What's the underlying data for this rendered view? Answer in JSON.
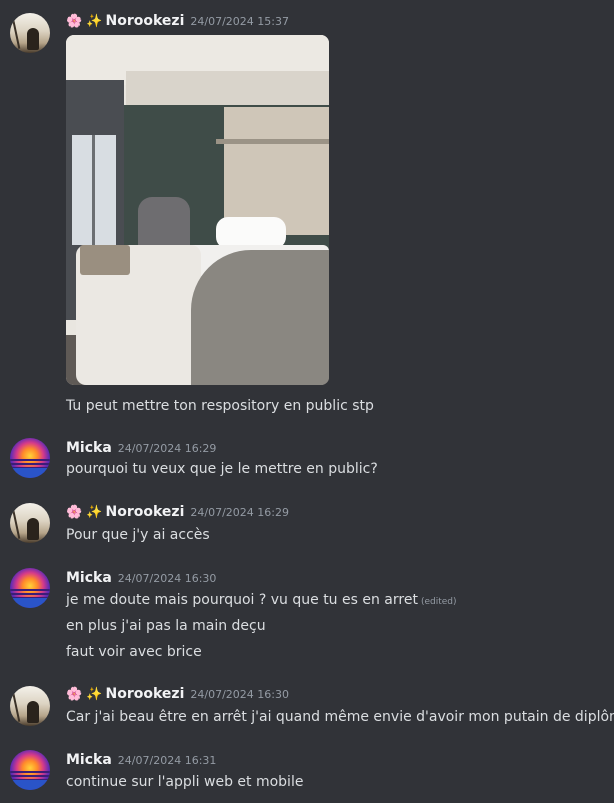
{
  "users": {
    "norookezi": {
      "emojis": "🌸 ✨",
      "name": "Norookezi"
    },
    "micka": {
      "name": "Micka"
    }
  },
  "messages": [
    {
      "user": "Norookezi",
      "timestamp": "24/07/2024 15:37",
      "lines": [
        "Tu peut mettre ton respository en public stp"
      ],
      "has_image": true
    },
    {
      "user": "Micka",
      "timestamp": "24/07/2024 16:29",
      "lines": [
        "pourquoi tu veux que je le mettre en public?"
      ]
    },
    {
      "user": "Norookezi",
      "timestamp": "24/07/2024 16:29",
      "lines": [
        "Pour que j'y ai accès"
      ]
    },
    {
      "user": "Micka",
      "timestamp": "24/07/2024 16:30",
      "lines": [
        "je me doute mais pourquoi ? vu que tu es en arret",
        "en plus j'ai pas la main deçu",
        "faut voir avec brice"
      ],
      "edited_label": "(edited)"
    },
    {
      "user": "Norookezi",
      "timestamp": "24/07/2024 16:30",
      "lines": [
        "Car j'ai beau être en arrêt j'ai quand même envie d'avoir mon putain de diplôme"
      ]
    },
    {
      "user": "Micka",
      "timestamp": "24/07/2024 16:31",
      "lines": [
        "continue sur l'appli web et mobile"
      ]
    }
  ]
}
